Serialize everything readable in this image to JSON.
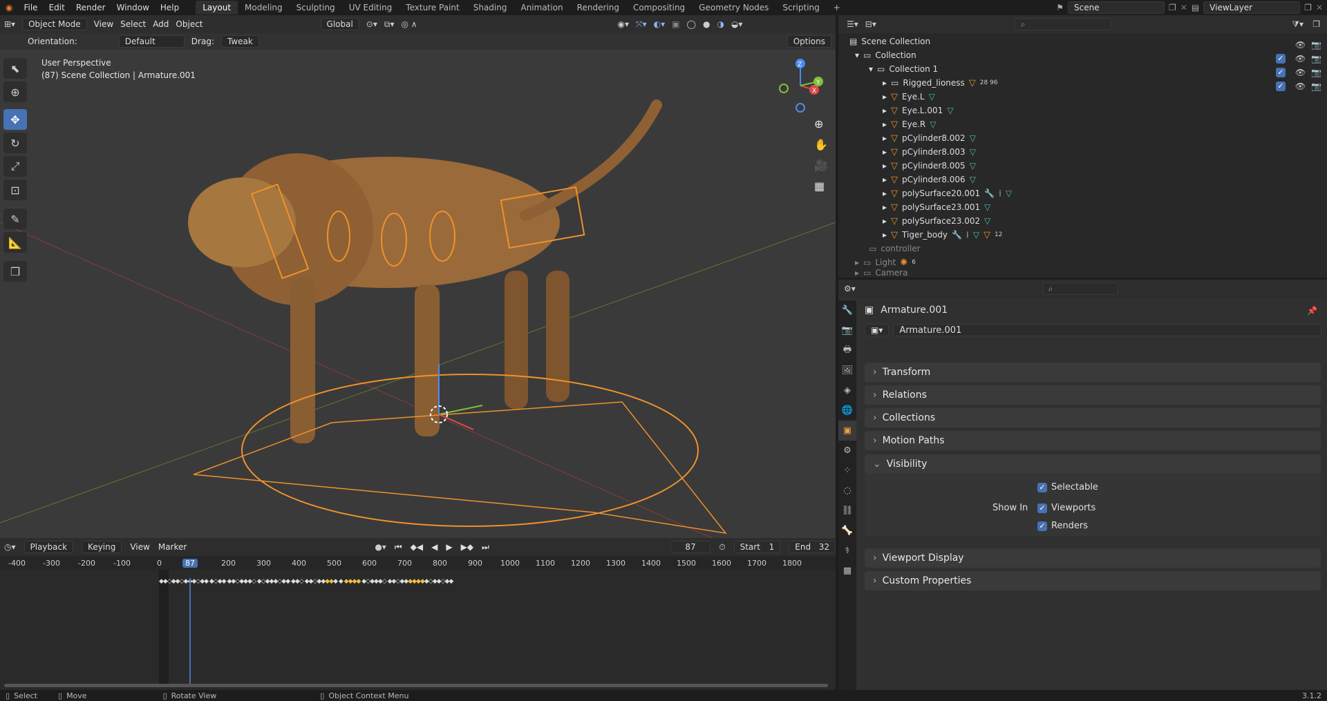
{
  "menu": {
    "items": [
      "File",
      "Edit",
      "Render",
      "Window",
      "Help"
    ]
  },
  "workspaces": [
    "Layout",
    "Modeling",
    "Sculpting",
    "UV Editing",
    "Texture Paint",
    "Shading",
    "Animation",
    "Rendering",
    "Compositing",
    "Geometry Nodes",
    "Scripting"
  ],
  "scene": {
    "name": "Scene",
    "view_layer": "ViewLayer"
  },
  "viewport": {
    "mode": "Object Mode",
    "menus": [
      "View",
      "Select",
      "Add",
      "Object"
    ],
    "orientation_label": "Orientation:",
    "orientation": "Default",
    "drag_label": "Drag:",
    "drag": "Tweak",
    "transform_space": "Global",
    "options": "Options",
    "overlay_title": "User Perspective",
    "overlay_sub": "(87) Scene Collection | Armature.001"
  },
  "timeline": {
    "menus": [
      "Playback",
      "Keying",
      "View",
      "Marker"
    ],
    "current_frame": "87",
    "start_label": "Start",
    "start": "1",
    "end_label": "End",
    "end": "32",
    "ruler": [
      "-400",
      "-300",
      "-200",
      "-100",
      "0",
      "87",
      "200",
      "300",
      "400",
      "500",
      "600",
      "700",
      "800",
      "900",
      "1000",
      "1100",
      "1200",
      "1300",
      "1400",
      "1500",
      "1600",
      "1700",
      "1800"
    ]
  },
  "outliner": {
    "rows": [
      {
        "name": "Scene Collection",
        "level": 0
      },
      {
        "name": "Collection",
        "level": 1
      },
      {
        "name": "Collection 1",
        "level": 2
      },
      {
        "name": "Rigged_lioness",
        "level": 3,
        "extra": "28 96"
      },
      {
        "name": "Eye.L",
        "level": 3
      },
      {
        "name": "Eye.L.001",
        "level": 3
      },
      {
        "name": "Eye.R",
        "level": 3
      },
      {
        "name": "pCylinder8.002",
        "level": 3
      },
      {
        "name": "pCylinder8.003",
        "level": 3
      },
      {
        "name": "pCylinder8.005",
        "level": 3
      },
      {
        "name": "pCylinder8.006",
        "level": 3
      },
      {
        "name": "polySurface20.001",
        "level": 3
      },
      {
        "name": "polySurface23.001",
        "level": 3
      },
      {
        "name": "polySurface23.002",
        "level": 3
      },
      {
        "name": "Tiger_body",
        "level": 3,
        "extra": "12"
      },
      {
        "name": "controller",
        "level": 1
      },
      {
        "name": "Light",
        "level": 1,
        "extra": "6"
      },
      {
        "name": "Camera",
        "level": 1
      }
    ]
  },
  "properties": {
    "object_name": "Armature.001",
    "data_name": "Armature.001",
    "panels": [
      "Transform",
      "Relations",
      "Collections",
      "Motion Paths",
      "Visibility",
      "Viewport Display",
      "Custom Properties"
    ],
    "visibility": {
      "selectable": "Selectable",
      "show_in": "Show In",
      "viewports": "Viewports",
      "renders": "Renders"
    }
  },
  "status": {
    "select": "Select",
    "move": "Move",
    "rotate": "Rotate View",
    "context": "Object Context Menu",
    "version": "3.1.2"
  },
  "colors": {
    "accent": "#4772b3",
    "selection": "#f0922b",
    "background": "#1d1d1d"
  }
}
